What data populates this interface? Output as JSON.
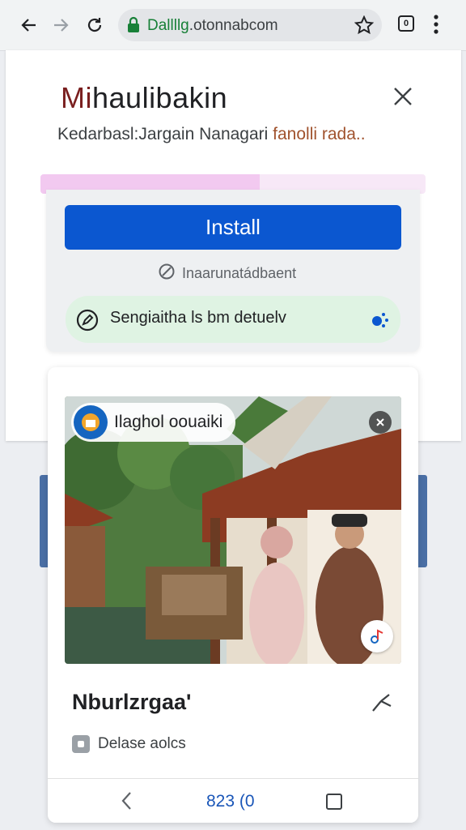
{
  "browser": {
    "url_domain": "Dallllg",
    "url_rest": ".otonnabcom",
    "tab_count": "0"
  },
  "install_sheet": {
    "title_first": "Mi",
    "title_rest": "haulibakin",
    "subtitle_main": "Kedarbasl:Jargain Nanagari ",
    "subtitle_accent": "fanolli rada..",
    "progress": 0.57,
    "install_label": "Install",
    "meta_text": "Inaarunatádbaent",
    "status_text": "Sengiaitha ls bm detuelv"
  },
  "post_card": {
    "chip_text": "Ilaghol oouaiki",
    "title": "Nburlzrgaa'",
    "meta_text": "Delase aolcs",
    "page_label": "823 (0"
  },
  "colors": {
    "accent_blue": "#0b57d0",
    "status_green": "#dff3e3",
    "progress_pink": "#f2c9f0"
  }
}
